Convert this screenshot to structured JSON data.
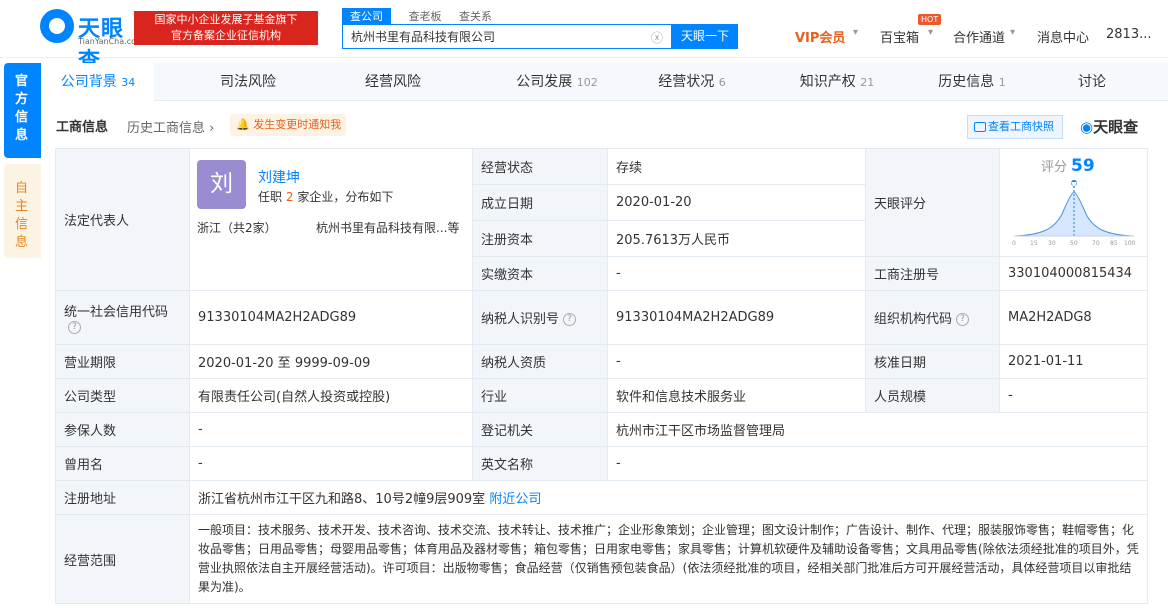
{
  "header": {
    "logo_name": "天眼查",
    "logo_domain": "TianYanCha.com",
    "gov_badge_line1": "国家中小企业发展子基金旗下",
    "gov_badge_line2": "官方备案企业征信机构",
    "search_tabs": [
      "查公司",
      "查老板",
      "查关系"
    ],
    "search_value": "杭州书里有品科技有限公司",
    "search_button": "天眼一下",
    "nav": [
      "VIP会员",
      "百宝箱",
      "合作通道",
      "消息中心",
      "2813..."
    ],
    "hot_badge": "HOT"
  },
  "side_tabs": [
    "官方信息",
    "自主信息"
  ],
  "tabs": [
    {
      "label": "公司背景",
      "count": "34"
    },
    {
      "label": "司法风险",
      "count": ""
    },
    {
      "label": "经营风险",
      "count": ""
    },
    {
      "label": "公司发展",
      "count": "102"
    },
    {
      "label": "经营状况",
      "count": "6"
    },
    {
      "label": "知识产权",
      "count": "21"
    },
    {
      "label": "历史信息",
      "count": "1"
    },
    {
      "label": "讨论",
      "count": ""
    }
  ],
  "section": {
    "title": "工商信息",
    "history_link": "历史工商信息",
    "notice": "发生变更时通知我",
    "view_button": "查看工商快照",
    "brand": "天眼查"
  },
  "legal_rep": {
    "label": "法定代表人",
    "avatar_char": "刘",
    "name": "刘建坤",
    "summary_prefix": "任职",
    "summary_count": "2",
    "summary_suffix": "家企业，分布如下",
    "province": "浙江（共2家）",
    "companies": "杭州书里有品科技有限...等"
  },
  "rows": {
    "status_label": "经营状态",
    "status_value": "存续",
    "founded_label": "成立日期",
    "founded_value": "2020-01-20",
    "reg_capital_label": "注册资本",
    "reg_capital_value": "205.7613万人民币",
    "paid_capital_label": "实缴资本",
    "paid_capital_value": "-",
    "score_label": "天眼评分",
    "score_title": "评分",
    "score_value": "59",
    "reg_no_label": "工商注册号",
    "reg_no_value": "330104000815434",
    "credit_code_label": "统一社会信用代码",
    "credit_code_value": "91330104MA2H2ADG89",
    "taxpayer_id_label": "纳税人识别号",
    "taxpayer_id_value": "91330104MA2H2ADG89",
    "org_code_label": "组织机构代码",
    "org_code_value": "MA2H2ADG8",
    "term_label": "营业期限",
    "term_value": "2020-01-20  至 9999-09-09",
    "taxpayer_qual_label": "纳税人资质",
    "taxpayer_qual_value": "-",
    "approve_label": "核准日期",
    "approve_value": "2021-01-11",
    "type_label": "公司类型",
    "type_value": "有限责任公司(自然人投资或控股)",
    "industry_label": "行业",
    "industry_value": "软件和信息技术服务业",
    "staff_label": "人员规模",
    "staff_value": "-",
    "insured_label": "参保人数",
    "insured_value": "-",
    "authority_label": "登记机关",
    "authority_value": "杭州市江干区市场监督管理局",
    "former_label": "曾用名",
    "former_value": "-",
    "english_label": "英文名称",
    "english_value": "-",
    "address_label": "注册地址",
    "address_value": "浙江省杭州市江干区九和路8、10号2幢9层909室",
    "address_link": "附近公司",
    "scope_label": "经营范围",
    "scope_value": "一般项目：技术服务、技术开发、技术咨询、技术交流、技术转让、技术推广；企业形象策划；企业管理；图文设计制作；广告设计、制作、代理；服装服饰零售；鞋帽零售；化妆品零售；日用品零售；母婴用品零售；体育用品及器材零售；箱包零售；日用家电零售；家具零售；计算机软硬件及辅助设备零售；文具用品零售(除依法须经批准的项目外，凭营业执照依法自主开展经营活动)。许可项目：出版物零售；食品经营（仅销售预包装食品）(依法须经批准的项目，经相关部门批准后方可开展经营活动，具体经营项目以审批结果为准)。"
  },
  "score_chart": {
    "ticks": [
      "0",
      "15",
      "30",
      "50",
      "70",
      "85",
      "100"
    ]
  }
}
